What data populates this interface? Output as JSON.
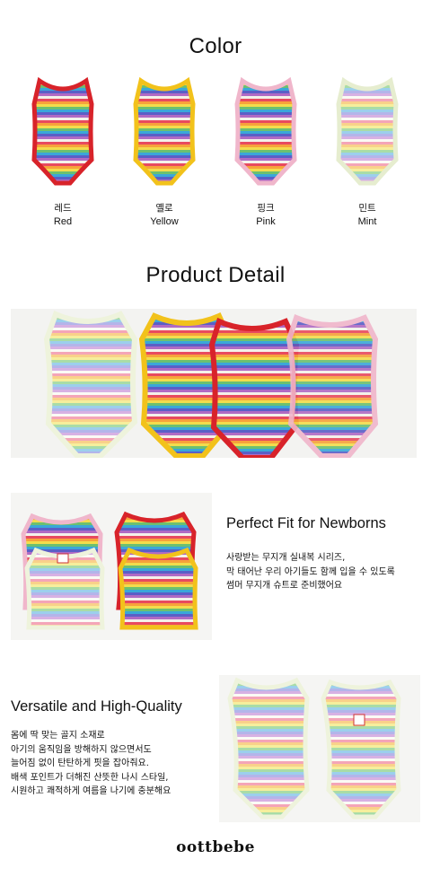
{
  "color_section": {
    "title": "Color",
    "swatches": [
      {
        "ko": "레드",
        "en": "Red",
        "trim": "#d8232a"
      },
      {
        "ko": "옐로",
        "en": "Yellow",
        "trim": "#f2c21b"
      },
      {
        "ko": "핑크",
        "en": "Pink",
        "trim": "#f0b6cb"
      },
      {
        "ko": "민트",
        "en": "Mint",
        "trim": "#eef3dc"
      }
    ]
  },
  "detail_section": {
    "title": "Product Detail"
  },
  "feature_fit": {
    "heading": "Perfect Fit for Newborns",
    "lines": [
      "사랑받는 무지개 실내복 시리즈,",
      "막 태어난 우리 아기들도 함께 입을 수 있도록",
      "썸머 무지개 슈트로 준비했어요"
    ]
  },
  "feature_quality": {
    "heading": "Versatile and High-Quality",
    "lines": [
      "몸에 딱 맞는 골지 소재로",
      "아기의 움직임을 방해하지 않으면서도",
      "늘어짐 없이 탄탄하게 핏을 잡아줘요.",
      "배색 포인트가 더해진 산뜻한 나시 스타일,",
      "시원하고 쾌적하게 여름을 나기에 충분해요"
    ]
  },
  "brand": "oottbebe"
}
